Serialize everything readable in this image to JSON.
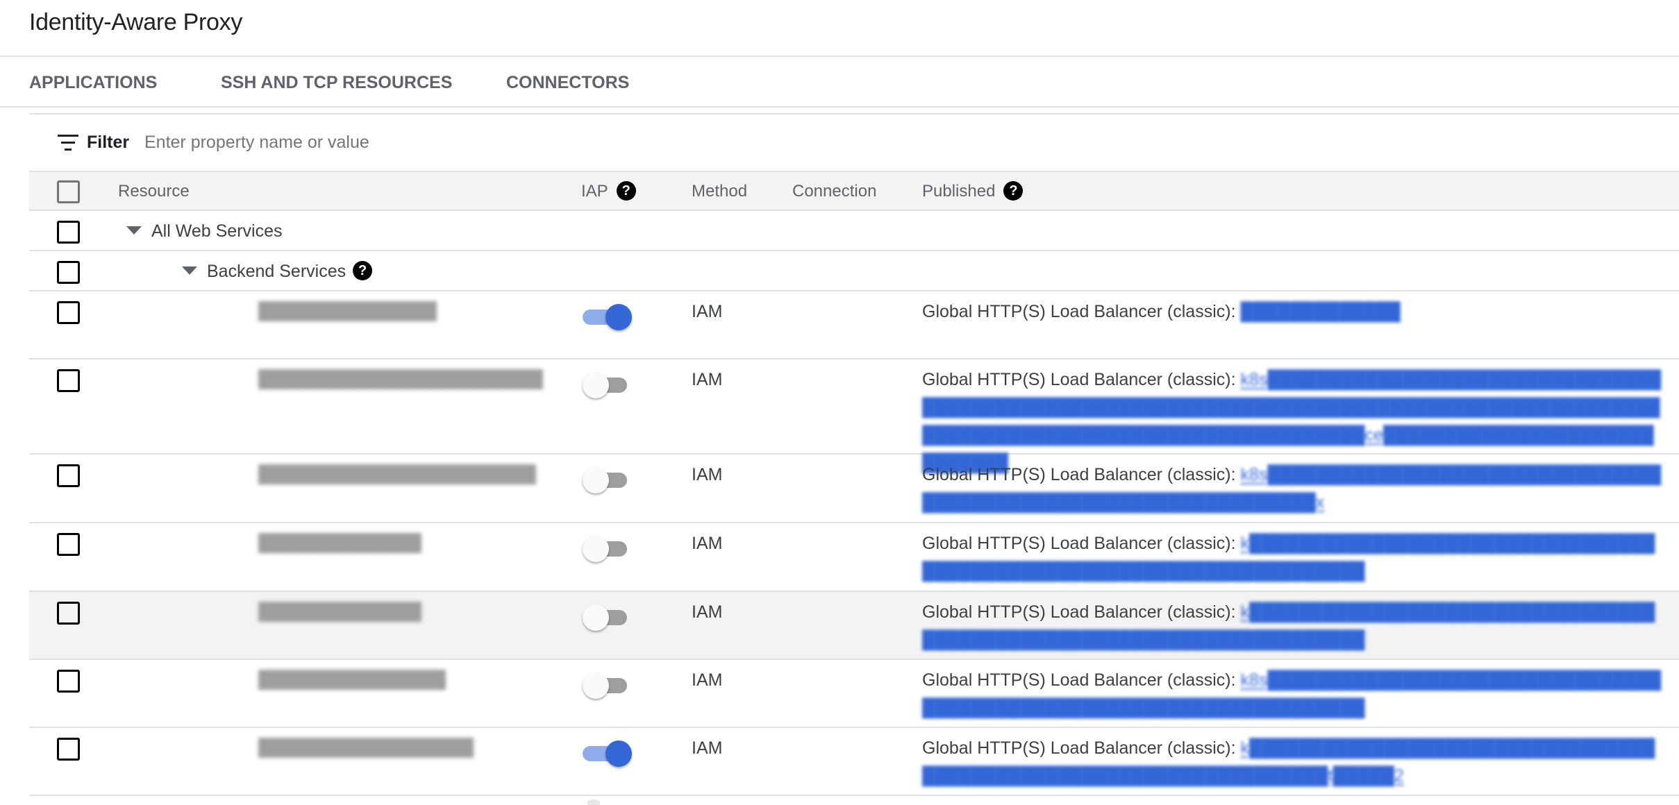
{
  "header": {
    "title": "Identity-Aware Proxy"
  },
  "tabs": [
    {
      "label": "APPLICATIONS"
    },
    {
      "label": "SSH AND TCP RESOURCES"
    },
    {
      "label": "CONNECTORS"
    }
  ],
  "filter": {
    "label": "Filter",
    "icon": "filter-list-icon",
    "placeholder": "Enter property name or value",
    "value": ""
  },
  "table": {
    "columns": {
      "resource": "Resource",
      "iap": "IAP",
      "iap_help": "?",
      "method": "Method",
      "connection": "Connection",
      "published": "Published",
      "published_help": "?"
    },
    "groups": {
      "all_web_services": "All Web Services",
      "backend_services": "Backend Services",
      "backend_services_help": "?"
    },
    "rows": [
      {
        "resource": "████████████████",
        "iap_enabled": true,
        "method": "IAM",
        "connection": "",
        "published_prefix": "Global HTTP(S) Load Balancer (classic):",
        "published_link": "█████████████",
        "highlighted": false
      },
      {
        "resource": "██████████████████████████",
        "iap_enabled": false,
        "method": "IAM",
        "connection": "",
        "published_prefix": "Global HTTP(S) Load Balancer (classic):",
        "published_link": "k8s████████████████████████████████████████████████████████████████████████████████████████████████████████████████████████████████ce█████████████████████████████",
        "highlighted": false
      },
      {
        "resource": "█████████████████████████",
        "iap_enabled": false,
        "method": "IAM",
        "connection": "",
        "published_prefix": "Global HTTP(S) Load Balancer (classic):",
        "published_link": "k8s████████████████████████████████████████████████████████████████x",
        "highlighted": false
      },
      {
        "resource": "███████████████",
        "iap_enabled": false,
        "method": "IAM",
        "connection": "",
        "published_prefix": "Global HTTP(S) Load Balancer (classic):",
        "published_link": "k█████████████████████████████████████████████████████████████████████",
        "highlighted": false
      },
      {
        "resource": "███████████████",
        "iap_enabled": false,
        "method": "IAM",
        "connection": "",
        "published_prefix": "Global HTTP(S) Load Balancer (classic):",
        "published_link": "k█████████████████████████████████████████████████████████████████████",
        "highlighted": true
      },
      {
        "resource": "█████████████████",
        "iap_enabled": false,
        "method": "IAM",
        "connection": "",
        "published_prefix": "Global HTTP(S) Load Balancer (classic):",
        "published_link": "k8s████████████████████████████████████████████████████████████████████",
        "highlighted": false
      },
      {
        "resource": "████████████████████",
        "iap_enabled": true,
        "method": "IAM",
        "connection": "",
        "published_prefix": "Global HTTP(S) Load Balancer (classic):",
        "published_link": "k██████████████████████████████████████████████████████████████████t█████2",
        "highlighted": false
      }
    ]
  },
  "colors": {
    "accent": "#3367d6",
    "toggle_track_on": "#8fadea",
    "toggle_track_off": "#9e9e9e",
    "header_bg": "#f3f3f3",
    "divider": "#e0e0e0"
  }
}
